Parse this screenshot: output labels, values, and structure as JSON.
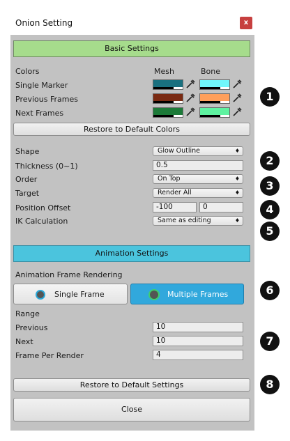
{
  "window": {
    "title": "Onion Setting",
    "close_label": "x"
  },
  "basic": {
    "header": "Basic Settings",
    "colors_label": "Colors",
    "col_mesh": "Mesh",
    "col_bone": "Bone",
    "rows": [
      {
        "label": "Single Marker",
        "mesh": "#19707f",
        "bone": "#6ff7fb"
      },
      {
        "label": "Previous Frames",
        "mesh": "#7a2a12",
        "bone": "#ff9f5b"
      },
      {
        "label": "Next Frames",
        "mesh": "#1c7a38",
        "bone": "#5ff3a1"
      }
    ],
    "restore_colors": "Restore to Default Colors",
    "shape_label": "Shape",
    "shape_value": "Glow Outline",
    "thickness_label": "Thickness (0~1)",
    "thickness_value": "0.5",
    "order_label": "Order",
    "order_value": "On Top",
    "target_label": "Target",
    "target_value": "Render All",
    "offset_label": "Position Offset",
    "offset_x": "-100",
    "offset_y": "0",
    "ik_label": "IK Calculation",
    "ik_value": "Same as editing"
  },
  "anim": {
    "header": "Animation Settings",
    "rendering_label": "Animation Frame Rendering",
    "single_frame": "Single Frame",
    "multiple_frames": "Multiple Frames",
    "range_label": "Range",
    "previous_label": "Previous",
    "previous_value": "10",
    "next_label": "Next",
    "next_value": "10",
    "fpr_label": "Frame Per Render",
    "fpr_value": "4",
    "restore_settings": "Restore to Default Settings",
    "close": "Close"
  },
  "badges": [
    "1",
    "2",
    "3",
    "4",
    "5",
    "6",
    "7",
    "8"
  ],
  "colors": {
    "basic_header": "#a6dc8c",
    "anim_header": "#4bc4dd",
    "selected_button": "#31a8dc",
    "close_red": "#c7403f"
  }
}
